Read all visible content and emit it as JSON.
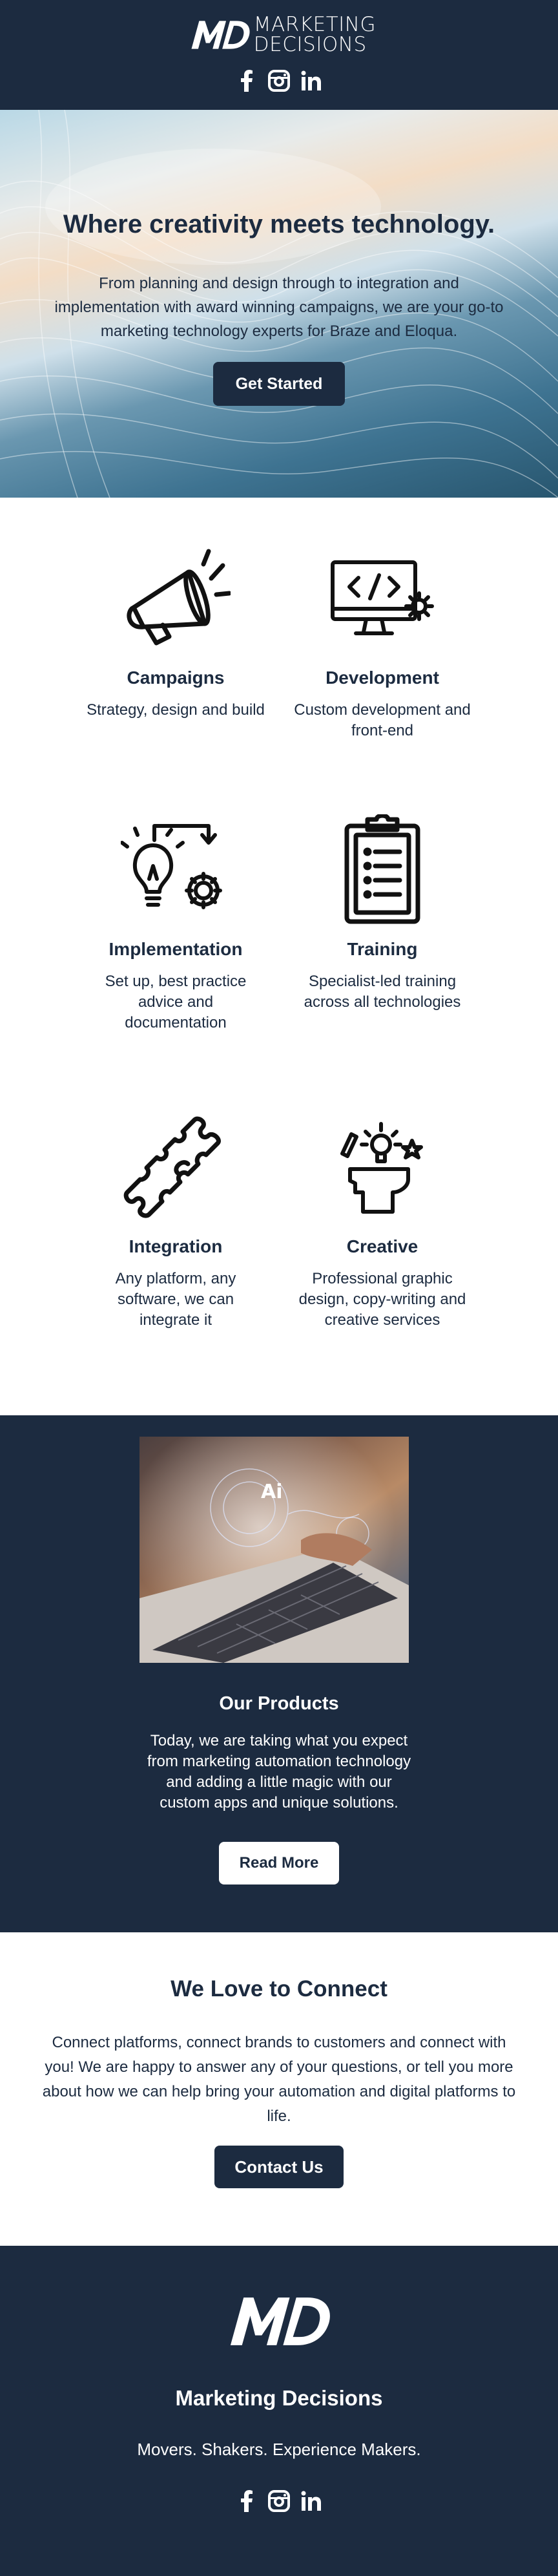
{
  "header": {
    "brand_line1": "MARKETING",
    "brand_line2": "DECISIONS",
    "social": [
      "facebook-icon",
      "instagram-icon",
      "linkedin-icon"
    ]
  },
  "hero": {
    "title": "Where creativity meets technology.",
    "text": "From planning and design through to integration and implementation with award winning campaigns, we are your go-to marketing technology experts for Braze and Eloqua.",
    "cta": "Get Started"
  },
  "services": [
    {
      "icon": "megaphone-icon",
      "title": "Campaigns",
      "text": "Strategy, design and build"
    },
    {
      "icon": "code-monitor-icon",
      "title": "Development",
      "text": "Custom development and front-end"
    },
    {
      "icon": "lightbulb-gear-icon",
      "title": "Implementation",
      "text": "Set up, best practice advice and documentation"
    },
    {
      "icon": "clipboard-icon",
      "title": "Training",
      "text": "Specialist-led training across all technologies"
    },
    {
      "icon": "puzzle-icon",
      "title": "Integration",
      "text": "Any platform, any software, we can integrate it"
    },
    {
      "icon": "creative-head-icon",
      "title": "Creative",
      "text": "Professional graphic design, copy-writing and creative services"
    }
  ],
  "products": {
    "image_label": "Ai",
    "title": "Our Products",
    "text": "Today, we are taking what you expect from marketing automation technology and adding a little magic with our custom apps and unique solutions.",
    "cta": "Read More"
  },
  "connect": {
    "title": "We Love to Connect",
    "text": "Connect platforms, connect brands to customers and connect with you! We are happy to answer any of your questions, or tell you more about how we can help bring your automation and digital platforms to life.",
    "cta": "Contact Us"
  },
  "footer": {
    "name": "Marketing Decisions",
    "tagline": "Movers. Shakers. Experience Makers."
  },
  "colors": {
    "navy": "#1c2b40",
    "white": "#ffffff"
  }
}
